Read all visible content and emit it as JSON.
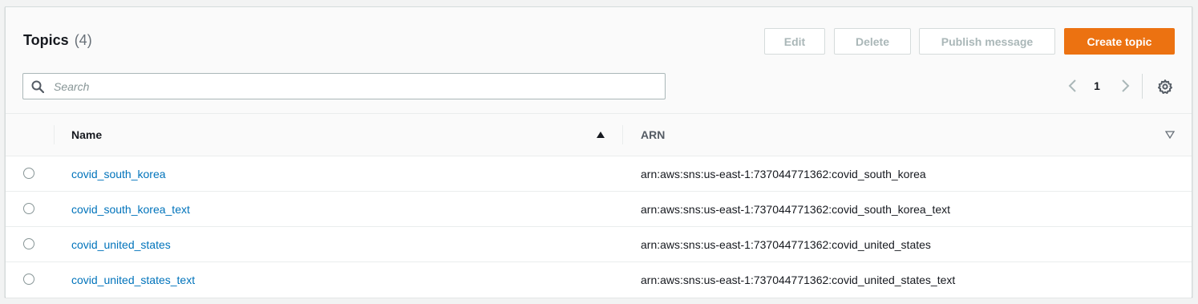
{
  "header": {
    "title": "Topics",
    "count": "(4)",
    "buttons": {
      "edit": "Edit",
      "delete": "Delete",
      "publish": "Publish message",
      "create": "Create topic"
    }
  },
  "search": {
    "placeholder": "Search",
    "value": ""
  },
  "pagination": {
    "current_page": "1"
  },
  "table": {
    "columns": [
      "Name",
      "ARN"
    ],
    "sort": {
      "Name": "ascending"
    },
    "rows": [
      {
        "name": "covid_south_korea",
        "arn": "arn:aws:sns:us-east-1:737044771362:covid_south_korea"
      },
      {
        "name": "covid_south_korea_text",
        "arn": "arn:aws:sns:us-east-1:737044771362:covid_south_korea_text"
      },
      {
        "name": "covid_united_states",
        "arn": "arn:aws:sns:us-east-1:737044771362:covid_united_states"
      },
      {
        "name": "covid_united_states_text",
        "arn": "arn:aws:sns:us-east-1:737044771362:covid_united_states_text"
      }
    ]
  },
  "icons": {
    "search": "search-icon",
    "prev": "chevron-left-icon",
    "next": "chevron-right-icon",
    "settings": "gear-icon",
    "sort_asc": "caret-up-icon",
    "sort_desc": "caret-down-icon"
  },
  "colors": {
    "primary_button": "#ec7211",
    "link": "#0073bb",
    "disabled_text": "#aab7b8",
    "panel_border": "#d5dbdb"
  }
}
